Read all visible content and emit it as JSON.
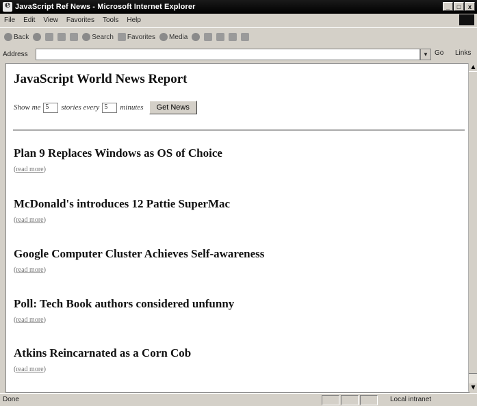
{
  "window": {
    "title": "JavaScript Ref News - Microsoft Internet Explorer",
    "controls": [
      "_",
      "□",
      "x"
    ]
  },
  "menu": [
    "File",
    "Edit",
    "View",
    "Favorites",
    "Tools",
    "Help"
  ],
  "toolbar": {
    "back": "Back",
    "search": "Search",
    "favorites": "Favorites",
    "media": "Media"
  },
  "address": {
    "label": "Address",
    "value": "",
    "go": "Go",
    "links": "Links"
  },
  "page": {
    "title": "JavaScript World News Report",
    "show_me": "Show me",
    "stories_count": "5",
    "stories_every": "stories every",
    "minutes_value": "5",
    "minutes": "minutes",
    "button": "Get News",
    "stories": [
      {
        "headline": "Plan 9 Replaces Windows as OS of Choice",
        "more": "read more"
      },
      {
        "headline": "McDonald's introduces 12 Pattie SuperMac",
        "more": "read more"
      },
      {
        "headline": "Google Computer Cluster Achieves Self-awareness",
        "more": "read more"
      },
      {
        "headline": "Poll: Tech Book authors considered unfunny",
        "more": "read more"
      },
      {
        "headline": "Atkins Reincarnated as a Corn Cob",
        "more": "read more"
      }
    ]
  },
  "status": {
    "text": "Done",
    "zone": "Local intranet"
  }
}
